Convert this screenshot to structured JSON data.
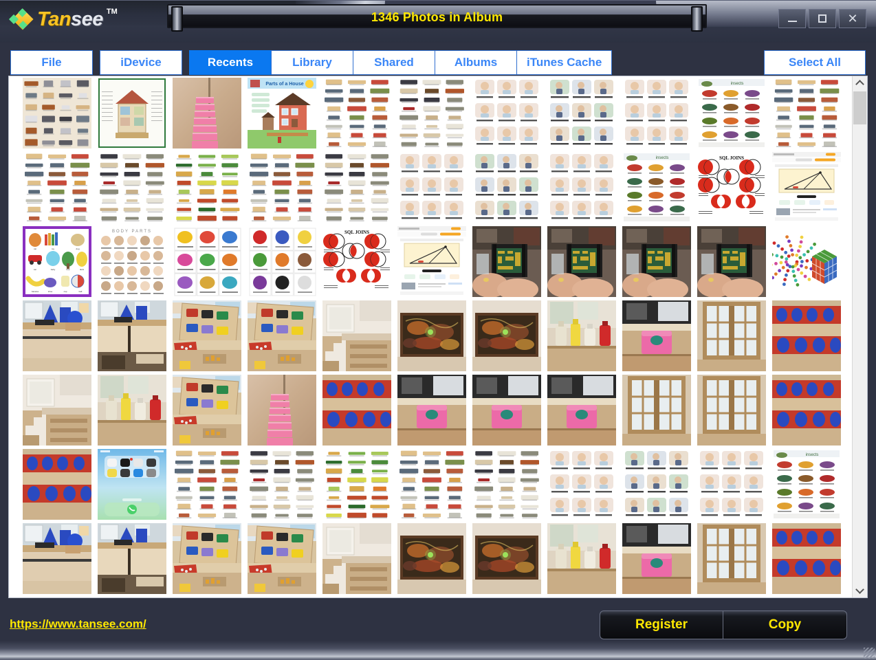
{
  "window": {
    "title": "1346 Photos in Album",
    "logo": {
      "part1": "Tan",
      "part2": "see",
      "tm": "TM"
    },
    "controls": {
      "minimize": "minimize-button",
      "maximize": "maximize-button",
      "close": "close-button"
    }
  },
  "toolbar": {
    "tabs": [
      {
        "label": "File",
        "active": false
      },
      {
        "label": "iDevice",
        "active": false
      },
      {
        "label": "Recents",
        "active": true
      },
      {
        "label": "Library",
        "active": false
      },
      {
        "label": "Shared",
        "active": false
      },
      {
        "label": "Albums",
        "active": false
      },
      {
        "label": "iTunes Cache",
        "active": false
      }
    ],
    "select_all": "Select All"
  },
  "scrollbar": {
    "up": "▲",
    "down": "▼",
    "position_percent": 3
  },
  "footer": {
    "url": "https://www.tansee.com/",
    "register": "Register",
    "copy": "Copy"
  },
  "colors": {
    "accent_blue": "#0a78f0",
    "tab_text": "#3a86f7",
    "title_yellow": "#ffe800",
    "window_bg": "#2e3242",
    "panel_bg": "#ffffff"
  },
  "grid": {
    "columns": 11,
    "rows": 7,
    "selected_index": 1,
    "thumbs": [
      {
        "kind": "poster-appliances",
        "label": "Household Devices and Appliances",
        "selected": false
      },
      {
        "kind": "poster-house-cutaway",
        "label": "House cutaway diagram",
        "selected": true
      },
      {
        "kind": "photo-pink-stack",
        "label": "Pink stacking blocks",
        "selected": false
      },
      {
        "kind": "poster-parts-house",
        "label": "Parts of a House",
        "selected": false
      },
      {
        "kind": "poster-vocab-rows",
        "label": "Vocabulary chart",
        "selected": false
      },
      {
        "kind": "poster-vocab-rows2",
        "label": "Vocabulary chart",
        "selected": false
      },
      {
        "kind": "poster-daily-routine",
        "label": "Daily routine flashcards",
        "selected": false
      },
      {
        "kind": "poster-chores",
        "label": "Household chores flashcards",
        "selected": false
      },
      {
        "kind": "poster-daily-routine",
        "label": "Daily routine flashcards",
        "selected": false
      },
      {
        "kind": "poster-insects",
        "label": "Insects poster",
        "selected": false
      },
      {
        "kind": "poster-vocab-rows",
        "label": "Vocabulary chart",
        "selected": false
      },
      {
        "kind": "poster-vocab-rows",
        "label": "Vocabulary chart",
        "selected": false
      },
      {
        "kind": "poster-vocab-rows2",
        "label": "Vocabulary chart",
        "selected": false
      },
      {
        "kind": "poster-vocab-green",
        "label": "Vocabulary chart",
        "selected": false
      },
      {
        "kind": "poster-vocab-rows",
        "label": "Vocabulary chart",
        "selected": false
      },
      {
        "kind": "poster-vocab-rows2",
        "label": "Vocabulary chart",
        "selected": false
      },
      {
        "kind": "poster-daily-routine",
        "label": "Daily routine flashcards",
        "selected": false
      },
      {
        "kind": "poster-chores",
        "label": "Household chores flashcards",
        "selected": false
      },
      {
        "kind": "poster-daily-routine",
        "label": "Daily routine flashcards",
        "selected": false
      },
      {
        "kind": "poster-insects",
        "label": "Insects poster",
        "selected": false
      },
      {
        "kind": "diagram-sql-joins",
        "label": "SQL JOINS diagram",
        "selected": false
      },
      {
        "kind": "screenshot-triangle",
        "label": "Geometry triangle web page",
        "selected": false
      },
      {
        "kind": "poster-first-words",
        "label": "First Words chart",
        "selected": false
      },
      {
        "kind": "poster-body-parts",
        "label": "Body Parts chart",
        "selected": false
      },
      {
        "kind": "poster-toys",
        "label": "Toys flashcards",
        "selected": false
      },
      {
        "kind": "poster-objects",
        "label": "Objects flashcards",
        "selected": false
      },
      {
        "kind": "diagram-sql-joins",
        "label": "SQL JOINS diagram",
        "selected": false
      },
      {
        "kind": "screenshot-triangle",
        "label": "Geometry triangle web page",
        "selected": false
      },
      {
        "kind": "photo-circuit-hand",
        "label": "Hand holding circuit board",
        "selected": false
      },
      {
        "kind": "photo-circuit-hand",
        "label": "Hand holding circuit board",
        "selected": false
      },
      {
        "kind": "photo-circuit-hand",
        "label": "Hand holding circuit board",
        "selected": false
      },
      {
        "kind": "photo-circuit-hand",
        "label": "Hand holding circuit board",
        "selected": false
      },
      {
        "kind": "diagram-colorcube",
        "label": "Color cube diagram",
        "selected": false
      },
      {
        "kind": "photo-blue-shapes",
        "label": "Classroom blue shapes",
        "selected": false
      },
      {
        "kind": "photo-desk-edge",
        "label": "Classroom desk",
        "selected": false
      },
      {
        "kind": "photo-puzzle-board",
        "label": "Wooden puzzle board",
        "selected": false
      },
      {
        "kind": "photo-puzzle-board",
        "label": "Wooden puzzle board",
        "selected": false
      },
      {
        "kind": "photo-stairs-art",
        "label": "Stairs with artwork",
        "selected": false
      },
      {
        "kind": "photo-artwork",
        "label": "Framed artwork",
        "selected": false
      },
      {
        "kind": "photo-artwork",
        "label": "Framed artwork",
        "selected": false
      },
      {
        "kind": "photo-bottles",
        "label": "Bottles on table",
        "selected": false
      },
      {
        "kind": "photo-cube-box",
        "label": "Colored cube box",
        "selected": false
      },
      {
        "kind": "photo-cabinet",
        "label": "Glass cabinet",
        "selected": false
      },
      {
        "kind": "photo-red-blue-shelf",
        "label": "Red and blue shelf",
        "selected": false
      },
      {
        "kind": "photo-stairs-art",
        "label": "Stairs with artwork",
        "selected": false
      },
      {
        "kind": "photo-bottles",
        "label": "Bottles on table",
        "selected": false
      },
      {
        "kind": "photo-puzzle-board",
        "label": "Wooden puzzle board",
        "selected": false
      },
      {
        "kind": "photo-pink-stack",
        "label": "Pink stacking blocks",
        "selected": false
      },
      {
        "kind": "photo-red-blue-shelf",
        "label": "Red and blue shelf",
        "selected": false
      },
      {
        "kind": "photo-cube-box",
        "label": "Colored cube box",
        "selected": false
      },
      {
        "kind": "photo-cube-box",
        "label": "Colored cube box",
        "selected": false
      },
      {
        "kind": "photo-cube-box",
        "label": "Colored cube box",
        "selected": false
      },
      {
        "kind": "photo-cabinet",
        "label": "Glass cabinet",
        "selected": false
      },
      {
        "kind": "photo-cabinet",
        "label": "Glass cabinet",
        "selected": false
      },
      {
        "kind": "photo-red-blue-shelf",
        "label": "Red and blue shelf",
        "selected": false
      },
      {
        "kind": "photo-red-blue-shelf",
        "label": "Red and blue shelf",
        "selected": false
      },
      {
        "kind": "screenshot-phone",
        "label": "Phone home screen",
        "selected": false
      },
      {
        "kind": "poster-vocab-rows",
        "label": "Vocabulary chart",
        "selected": false
      },
      {
        "kind": "poster-vocab-rows2",
        "label": "Vocabulary chart",
        "selected": false
      },
      {
        "kind": "poster-vocab-green",
        "label": "Vocabulary chart",
        "selected": false
      },
      {
        "kind": "poster-vocab-rows",
        "label": "Vocabulary chart",
        "selected": false
      },
      {
        "kind": "poster-vocab-rows2",
        "label": "Vocabulary chart",
        "selected": false
      },
      {
        "kind": "poster-daily-routine",
        "label": "Daily routine flashcards",
        "selected": false
      },
      {
        "kind": "poster-chores",
        "label": "Household chores flashcards",
        "selected": false
      },
      {
        "kind": "poster-daily-routine",
        "label": "Daily routine flashcards",
        "selected": false
      },
      {
        "kind": "poster-insects",
        "label": "Insects poster",
        "selected": false
      },
      {
        "kind": "photo-blue-shapes",
        "label": "Classroom blue shapes",
        "selected": false
      },
      {
        "kind": "photo-desk-edge",
        "label": "Classroom desk",
        "selected": false
      },
      {
        "kind": "photo-puzzle-board",
        "label": "Wooden puzzle board",
        "selected": false
      },
      {
        "kind": "photo-puzzle-board",
        "label": "Wooden puzzle board",
        "selected": false
      },
      {
        "kind": "photo-stairs-art",
        "label": "Stairs with artwork",
        "selected": false
      },
      {
        "kind": "photo-artwork",
        "label": "Framed artwork",
        "selected": false
      },
      {
        "kind": "photo-artwork",
        "label": "Framed artwork",
        "selected": false
      },
      {
        "kind": "photo-bottles",
        "label": "Bottles on table",
        "selected": false
      },
      {
        "kind": "photo-cube-box",
        "label": "Colored cube box",
        "selected": false
      },
      {
        "kind": "photo-cabinet",
        "label": "Glass cabinet",
        "selected": false
      },
      {
        "kind": "photo-red-blue-shelf",
        "label": "Red and blue shelf",
        "selected": false
      }
    ]
  }
}
